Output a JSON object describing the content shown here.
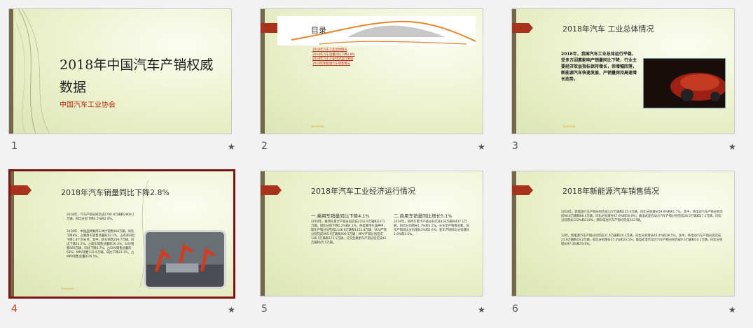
{
  "slides": [
    {
      "number": "1",
      "title": "2018年中国汽车产销权威数据",
      "subtitle": "中国汽车工业协会"
    },
    {
      "number": "2",
      "title": "目录",
      "items": [
        "2018年汽车工业总体情况",
        "2018年汽车销量同比下降2.8%",
        "2018年汽车工业经济运行情况",
        "2018年新能源汽车销售情况"
      ]
    },
    {
      "number": "3",
      "title": "2018年汽车 工业总体情况",
      "body": "2018年，我国汽车工业总体运行平稳，受多方因素影响产销量同比下降，行业主要经济效益指标保持增长，但增幅回落，新能源汽车快速发展，产销量保持高速增长态势。"
    },
    {
      "number": "4",
      "title": "2018年汽车销量同比下降2.8%",
      "bullet1": "2018年，汽车产销分别完成2780.9万辆和2808.1万辆，同比分别下降4.2%和2.8%。",
      "bullet2": "2018年，中国品牌乘用车共计销售998万辆，同比下降8%，占乘用车销售总量的42.1%，占有率同比下降1.8个百分点；其中，轿车销售239.7万辆，同比下降23.1%，占轿车销售总量的20.3%；SUV销售560万辆，同比下降6.7%，占SUV销售总量的58%；MPV销售132.6万辆，同比下降23.1%，占MPV销售总量的76.5%。"
    },
    {
      "number": "5",
      "title": "2018年汽车工业经济运行情况",
      "col1_head": "一.乘用车销量同比下降4.1%",
      "col1_text": "2018年，乘用车累计产销分别完成2352.9万辆和2371万辆，同比分别下降5.2%和4.1%。四类乘用车品种中，轿车产销分别完成1146.6万辆和1152.8万辆；SUV产销分别完成995.9万辆和999.5万辆；MPV产销分别完成146.5万辆和173.5万辆；交叉型乘用车产销分别完成42万辆和45.5万辆。",
      "col2_head": "二.商用车销量同比增长5.1%",
      "col2_text": "2018年，商用车累计产销分别完成428万辆和437.1万辆，同比分别增长1.7%和5.1%。分车型产销情况看，货车产销同比分别增长2%和5.6%；客车产销同比分别增长2.9%和2.5%。"
    },
    {
      "number": "6",
      "title": "2018年新能源汽车销售情况",
      "p1": "2018年，新能源汽车产销分别完成127万辆和125.6万辆，同比分别增长59.9%和61.7%。其中，纯电动汽车产销分别完成98.6万辆和98.4万辆，同比分别增长47.9%和50.8%；插电式混合动力汽车产销分别完成28.3万辆和27.1万辆，同比分别增长122%和118%；燃料电池汽车产销均完成1527辆。",
      "p2": "12月，新能源汽车产销分别完成31.4万辆和29.3万辆，同比分别增长43.4%和38.5%。其中，纯电动汽车产销分别完成21.9万辆和19.2万辆，同比分别增长27.3%和23.5%；插电式混合动力汽车产销分别完成9.5万辆和10.1万辆，同比分别增长97.3%和79.6%。"
    }
  ],
  "footer_mark": "2019/4/26",
  "star": "★",
  "colors": {
    "accent": "#a8321c",
    "selection": "#7a1414",
    "bar": "#746848"
  }
}
